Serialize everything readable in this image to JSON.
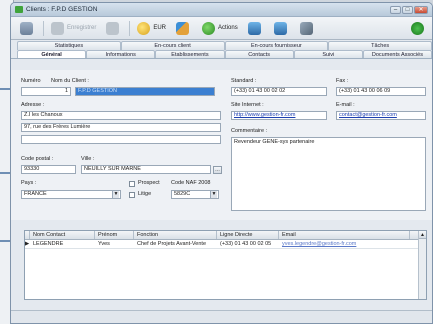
{
  "window": {
    "title": "Clients : F.P.D GESTION"
  },
  "toolbar": {
    "enregistrer_label": "Enregistrer",
    "eur_label": "EUR",
    "actions_label": "Actions"
  },
  "tabs_row1": [
    "Statistiques",
    "En-cours client",
    "En-cours fournisseur",
    "Tâches"
  ],
  "tabs_row2": [
    "Général",
    "Informations",
    "Etablissements",
    "Contacts",
    "Suivi",
    "Documents Associés"
  ],
  "active_tab": "Général",
  "form": {
    "numero_label": "Numéro",
    "numero_value": "1",
    "nom_label": "Nom du Client :",
    "nom_value": "F.P.D GESTION",
    "standard_label": "Standard :",
    "standard_value": "(+33) 01 43 00 02 02",
    "fax_label": "Fax :",
    "fax_value": "(+33) 01 43 00 06 09",
    "adresse_label": "Adresse :",
    "adresse_line1": "Z.I les Chanoux",
    "adresse_line2": "97, rue des Frères Lumière",
    "site_label": "Site Internet :",
    "site_value": "http://www.gestion-fr.com",
    "email_label": "E-mail :",
    "email_value": "contact@gestion-fr.com",
    "commentaire_label": "Commentaire :",
    "commentaire_value": "Revendeur GENE-sys partenaire",
    "cp_label": "Code postal :",
    "cp_value": "93330",
    "ville_label": "Ville :",
    "ville_value": "NEUILLY SUR MARNE",
    "pays_label": "Pays :",
    "pays_value": "FRANCE",
    "prospect_label": "Prospect",
    "litige_label": "Litige",
    "naf_label": "Code NAF 2008",
    "naf_value": "5829C"
  },
  "contacts": {
    "columns": [
      "Nom Contact",
      "Prénom",
      "Fonction",
      "Ligne Directe",
      "Email"
    ],
    "rows": [
      [
        "LEGENDRE",
        "Yves",
        "Chef de Projets Avant-Vente",
        "(+33) 01 43 00 02 05",
        "yves.legendre@gestion-fr.com"
      ]
    ]
  }
}
